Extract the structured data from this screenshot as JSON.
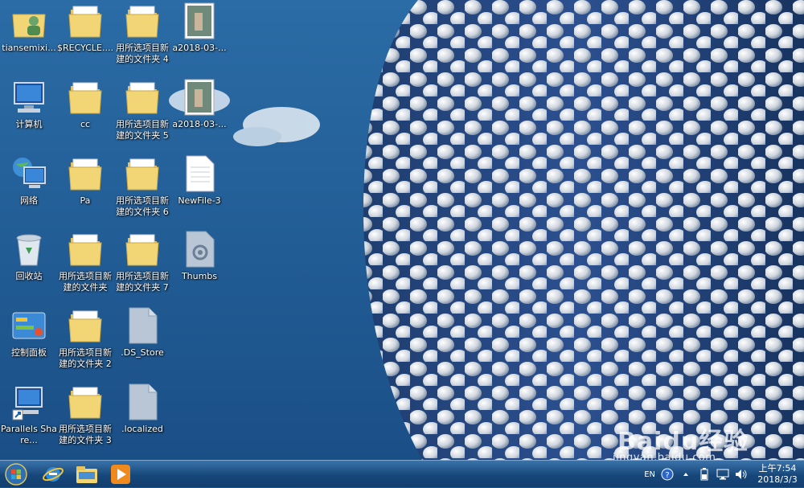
{
  "desktop": {
    "icons": [
      {
        "label": "tiansemixi...",
        "icon": "user-folder-icon"
      },
      {
        "label": "$RECYCLE....",
        "icon": "folder-icon"
      },
      {
        "label": "用所选项目新建的文件夹 4",
        "icon": "folder-icon"
      },
      {
        "label": "a2018-03-...",
        "icon": "image-file-icon"
      },
      {
        "label": "计算机",
        "icon": "computer-icon"
      },
      {
        "label": "cc",
        "icon": "folder-icon"
      },
      {
        "label": "用所选项目新建的文件夹 5",
        "icon": "folder-icon"
      },
      {
        "label": "a2018-03-...",
        "icon": "image-file-icon"
      },
      {
        "label": "网络",
        "icon": "network-icon"
      },
      {
        "label": "Pa",
        "icon": "folder-icon"
      },
      {
        "label": "用所选项目新建的文件夹 6",
        "icon": "folder-icon"
      },
      {
        "label": "NewFile-3",
        "icon": "text-file-icon"
      },
      {
        "label": "回收站",
        "icon": "recycle-bin-icon"
      },
      {
        "label": "用所选项目新建的文件夹",
        "icon": "folder-icon"
      },
      {
        "label": "用所选项目新建的文件夹 7",
        "icon": "folder-icon"
      },
      {
        "label": "Thumbs",
        "icon": "system-file-icon"
      },
      {
        "label": "控制面板",
        "icon": "control-panel-icon"
      },
      {
        "label": "用所选项目新建的文件夹 2",
        "icon": "folder-icon"
      },
      {
        "label": ".DS_Store",
        "icon": "blank-file-icon"
      },
      {
        "label": "Parallels Share...",
        "icon": "shortcut-icon"
      },
      {
        "label": "用所选项目新建的文件夹 3",
        "icon": "folder-icon"
      },
      {
        "label": ".localized",
        "icon": "blank-file-icon"
      }
    ]
  },
  "taskbar": {
    "pinned": [
      {
        "name": "start-button",
        "icon": "windows-orb-icon"
      },
      {
        "name": "internet-explorer",
        "icon": "internet-explorer-icon"
      },
      {
        "name": "windows-explorer",
        "icon": "explorer-folder-icon"
      },
      {
        "name": "media-player",
        "icon": "media-player-icon"
      }
    ],
    "tray": {
      "language": "EN",
      "time": "上午7:54",
      "date": "2018/3/3"
    }
  },
  "watermark": {
    "logo": "Baidu经验",
    "url": "jingyan.baidu.com"
  },
  "colors": {
    "sky": "#2a6aa5",
    "taskbar": "#17477a",
    "folder": "#f2d675"
  }
}
